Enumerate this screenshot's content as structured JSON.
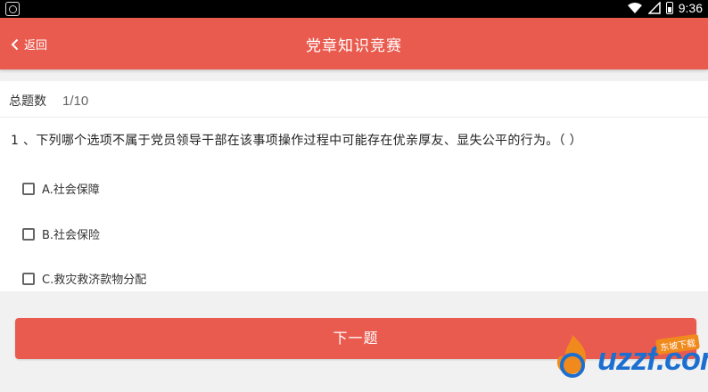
{
  "status_bar": {
    "time": "9:36"
  },
  "header": {
    "back_label": "返回",
    "title": "党章知识竞赛"
  },
  "quiz": {
    "count_label": "总题数",
    "count_value": "1/10",
    "question": "1 、下列哪个选项不属于党员领导干部在该事项操作过程中可能存在优亲厚友、显失公平的行为。（ ）",
    "options": [
      {
        "label": "A.社会保障",
        "checked": false
      },
      {
        "label": "B.社会保险",
        "checked": false
      },
      {
        "label": "C.救灾救济款物分配",
        "checked": false
      }
    ]
  },
  "next_button": {
    "label": "下一题"
  },
  "watermark": {
    "logo_text": "uzzf.com",
    "badge_text": "东坡下载"
  },
  "colors": {
    "accent": "#ea5b4f",
    "background": "#f1f1f1",
    "watermark_blue": "#1b6fd0"
  }
}
